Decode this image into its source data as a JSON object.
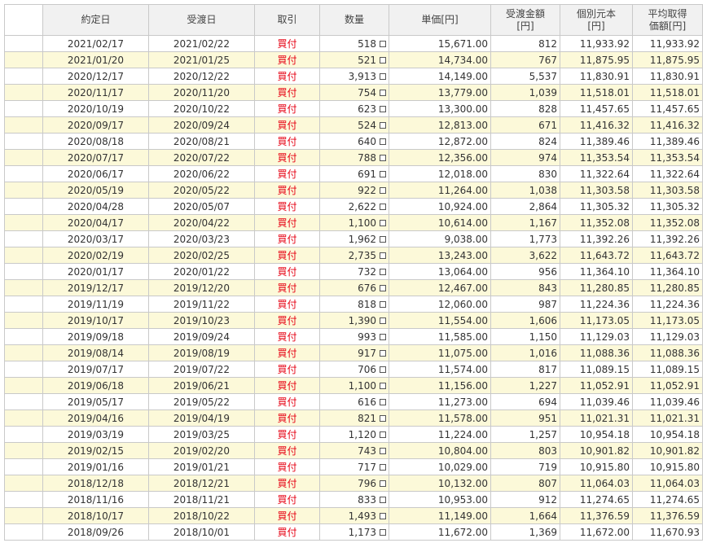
{
  "columns": [
    {
      "key": "check",
      "label": ""
    },
    {
      "key": "contract_date",
      "label": "約定日"
    },
    {
      "key": "delivery_date",
      "label": "受渡日"
    },
    {
      "key": "trade",
      "label": "取引"
    },
    {
      "key": "quantity",
      "label": "数量"
    },
    {
      "key": "unit_price",
      "label": "単価[円]"
    },
    {
      "key": "delivery_amount",
      "label": "受渡金額\n[円]"
    },
    {
      "key": "individual_principal",
      "label": "個別元本\n[円]"
    },
    {
      "key": "avg_cost",
      "label": "平均取得\n価額[円]"
    }
  ],
  "colors": {
    "header_bg": "#f1f1f1",
    "alt_row_bg": "#fcf9d9",
    "trade_text": "#e60012",
    "border": "#c9c9c9"
  },
  "rows": [
    {
      "contract_date": "2021/02/17",
      "delivery_date": "2021/02/22",
      "trade": "買付",
      "quantity": "518",
      "unit_price": "15,671.00",
      "delivery_amount": "812",
      "individual_principal": "11,933.92",
      "avg_cost": "11,933.92"
    },
    {
      "contract_date": "2021/01/20",
      "delivery_date": "2021/01/25",
      "trade": "買付",
      "quantity": "521",
      "unit_price": "14,734.00",
      "delivery_amount": "767",
      "individual_principal": "11,875.95",
      "avg_cost": "11,875.95"
    },
    {
      "contract_date": "2020/12/17",
      "delivery_date": "2020/12/22",
      "trade": "買付",
      "quantity": "3,913",
      "unit_price": "14,149.00",
      "delivery_amount": "5,537",
      "individual_principal": "11,830.91",
      "avg_cost": "11,830.91"
    },
    {
      "contract_date": "2020/11/17",
      "delivery_date": "2020/11/20",
      "trade": "買付",
      "quantity": "754",
      "unit_price": "13,779.00",
      "delivery_amount": "1,039",
      "individual_principal": "11,518.01",
      "avg_cost": "11,518.01"
    },
    {
      "contract_date": "2020/10/19",
      "delivery_date": "2020/10/22",
      "trade": "買付",
      "quantity": "623",
      "unit_price": "13,300.00",
      "delivery_amount": "828",
      "individual_principal": "11,457.65",
      "avg_cost": "11,457.65"
    },
    {
      "contract_date": "2020/09/17",
      "delivery_date": "2020/09/24",
      "trade": "買付",
      "quantity": "524",
      "unit_price": "12,813.00",
      "delivery_amount": "671",
      "individual_principal": "11,416.32",
      "avg_cost": "11,416.32"
    },
    {
      "contract_date": "2020/08/18",
      "delivery_date": "2020/08/21",
      "trade": "買付",
      "quantity": "640",
      "unit_price": "12,872.00",
      "delivery_amount": "824",
      "individual_principal": "11,389.46",
      "avg_cost": "11,389.46"
    },
    {
      "contract_date": "2020/07/17",
      "delivery_date": "2020/07/22",
      "trade": "買付",
      "quantity": "788",
      "unit_price": "12,356.00",
      "delivery_amount": "974",
      "individual_principal": "11,353.54",
      "avg_cost": "11,353.54"
    },
    {
      "contract_date": "2020/06/17",
      "delivery_date": "2020/06/22",
      "trade": "買付",
      "quantity": "691",
      "unit_price": "12,018.00",
      "delivery_amount": "830",
      "individual_principal": "11,322.64",
      "avg_cost": "11,322.64"
    },
    {
      "contract_date": "2020/05/19",
      "delivery_date": "2020/05/22",
      "trade": "買付",
      "quantity": "922",
      "unit_price": "11,264.00",
      "delivery_amount": "1,038",
      "individual_principal": "11,303.58",
      "avg_cost": "11,303.58"
    },
    {
      "contract_date": "2020/04/28",
      "delivery_date": "2020/05/07",
      "trade": "買付",
      "quantity": "2,622",
      "unit_price": "10,924.00",
      "delivery_amount": "2,864",
      "individual_principal": "11,305.32",
      "avg_cost": "11,305.32"
    },
    {
      "contract_date": "2020/04/17",
      "delivery_date": "2020/04/22",
      "trade": "買付",
      "quantity": "1,100",
      "unit_price": "10,614.00",
      "delivery_amount": "1,167",
      "individual_principal": "11,352.08",
      "avg_cost": "11,352.08"
    },
    {
      "contract_date": "2020/03/17",
      "delivery_date": "2020/03/23",
      "trade": "買付",
      "quantity": "1,962",
      "unit_price": "9,038.00",
      "delivery_amount": "1,773",
      "individual_principal": "11,392.26",
      "avg_cost": "11,392.26"
    },
    {
      "contract_date": "2020/02/19",
      "delivery_date": "2020/02/25",
      "trade": "買付",
      "quantity": "2,735",
      "unit_price": "13,243.00",
      "delivery_amount": "3,622",
      "individual_principal": "11,643.72",
      "avg_cost": "11,643.72"
    },
    {
      "contract_date": "2020/01/17",
      "delivery_date": "2020/01/22",
      "trade": "買付",
      "quantity": "732",
      "unit_price": "13,064.00",
      "delivery_amount": "956",
      "individual_principal": "11,364.10",
      "avg_cost": "11,364.10"
    },
    {
      "contract_date": "2019/12/17",
      "delivery_date": "2019/12/20",
      "trade": "買付",
      "quantity": "676",
      "unit_price": "12,467.00",
      "delivery_amount": "843",
      "individual_principal": "11,280.85",
      "avg_cost": "11,280.85"
    },
    {
      "contract_date": "2019/11/19",
      "delivery_date": "2019/11/22",
      "trade": "買付",
      "quantity": "818",
      "unit_price": "12,060.00",
      "delivery_amount": "987",
      "individual_principal": "11,224.36",
      "avg_cost": "11,224.36"
    },
    {
      "contract_date": "2019/10/17",
      "delivery_date": "2019/10/23",
      "trade": "買付",
      "quantity": "1,390",
      "unit_price": "11,554.00",
      "delivery_amount": "1,606",
      "individual_principal": "11,173.05",
      "avg_cost": "11,173.05"
    },
    {
      "contract_date": "2019/09/18",
      "delivery_date": "2019/09/24",
      "trade": "買付",
      "quantity": "993",
      "unit_price": "11,585.00",
      "delivery_amount": "1,150",
      "individual_principal": "11,129.03",
      "avg_cost": "11,129.03"
    },
    {
      "contract_date": "2019/08/14",
      "delivery_date": "2019/08/19",
      "trade": "買付",
      "quantity": "917",
      "unit_price": "11,075.00",
      "delivery_amount": "1,016",
      "individual_principal": "11,088.36",
      "avg_cost": "11,088.36"
    },
    {
      "contract_date": "2019/07/17",
      "delivery_date": "2019/07/22",
      "trade": "買付",
      "quantity": "706",
      "unit_price": "11,574.00",
      "delivery_amount": "817",
      "individual_principal": "11,089.15",
      "avg_cost": "11,089.15"
    },
    {
      "contract_date": "2019/06/18",
      "delivery_date": "2019/06/21",
      "trade": "買付",
      "quantity": "1,100",
      "unit_price": "11,156.00",
      "delivery_amount": "1,227",
      "individual_principal": "11,052.91",
      "avg_cost": "11,052.91"
    },
    {
      "contract_date": "2019/05/17",
      "delivery_date": "2019/05/22",
      "trade": "買付",
      "quantity": "616",
      "unit_price": "11,273.00",
      "delivery_amount": "694",
      "individual_principal": "11,039.46",
      "avg_cost": "11,039.46"
    },
    {
      "contract_date": "2019/04/16",
      "delivery_date": "2019/04/19",
      "trade": "買付",
      "quantity": "821",
      "unit_price": "11,578.00",
      "delivery_amount": "951",
      "individual_principal": "11,021.31",
      "avg_cost": "11,021.31"
    },
    {
      "contract_date": "2019/03/19",
      "delivery_date": "2019/03/25",
      "trade": "買付",
      "quantity": "1,120",
      "unit_price": "11,224.00",
      "delivery_amount": "1,257",
      "individual_principal": "10,954.18",
      "avg_cost": "10,954.18"
    },
    {
      "contract_date": "2019/02/15",
      "delivery_date": "2019/02/20",
      "trade": "買付",
      "quantity": "743",
      "unit_price": "10,804.00",
      "delivery_amount": "803",
      "individual_principal": "10,901.82",
      "avg_cost": "10,901.82"
    },
    {
      "contract_date": "2019/01/16",
      "delivery_date": "2019/01/21",
      "trade": "買付",
      "quantity": "717",
      "unit_price": "10,029.00",
      "delivery_amount": "719",
      "individual_principal": "10,915.80",
      "avg_cost": "10,915.80"
    },
    {
      "contract_date": "2018/12/18",
      "delivery_date": "2018/12/21",
      "trade": "買付",
      "quantity": "796",
      "unit_price": "10,132.00",
      "delivery_amount": "807",
      "individual_principal": "11,064.03",
      "avg_cost": "11,064.03"
    },
    {
      "contract_date": "2018/11/16",
      "delivery_date": "2018/11/21",
      "trade": "買付",
      "quantity": "833",
      "unit_price": "10,953.00",
      "delivery_amount": "912",
      "individual_principal": "11,274.65",
      "avg_cost": "11,274.65"
    },
    {
      "contract_date": "2018/10/17",
      "delivery_date": "2018/10/22",
      "trade": "買付",
      "quantity": "1,493",
      "unit_price": "11,149.00",
      "delivery_amount": "1,664",
      "individual_principal": "11,376.59",
      "avg_cost": "11,376.59"
    },
    {
      "contract_date": "2018/09/26",
      "delivery_date": "2018/10/01",
      "trade": "買付",
      "quantity": "1,173",
      "unit_price": "11,672.00",
      "delivery_amount": "1,369",
      "individual_principal": "11,672.00",
      "avg_cost": "11,670.93"
    }
  ]
}
